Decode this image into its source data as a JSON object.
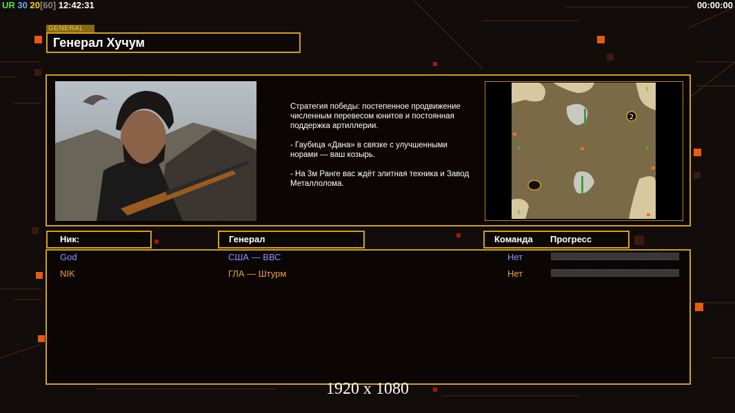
{
  "hud": {
    "fps_label": "UR",
    "fps_value": "30",
    "fps_limit": "20",
    "fps_max": "[60]",
    "clock": "12:42:31",
    "timer": "00:00:00"
  },
  "general": {
    "tag": "GENERAL",
    "name": "Генерал Хучум",
    "strategy": [
      "Стратегия победы: постепенное продвижение численным перевесом юнитов и постоянная поддержка артиллерии.",
      "- Гаубица «Дана» в связке с улучшенными норами — ваш козырь.",
      "- На 3м Ранге вас ждёт элитная техника и Завод Металлолома."
    ],
    "minimap_start_1": "2"
  },
  "table": {
    "headers": {
      "nick": "Ник:",
      "general": "Генерал",
      "team": "Команда",
      "progress": "Прогресс"
    },
    "rows": [
      {
        "nick": "God",
        "general": "США — ВВС",
        "team": "Нет",
        "progress": 0,
        "color": "#8f8fff"
      },
      {
        "nick": "NIK",
        "general": "ГЛА — Штурм",
        "team": "Нет",
        "progress": 0,
        "color": "#f0a040"
      }
    ]
  },
  "footer": {
    "resolution": "1920 x 1080"
  },
  "colors": {
    "accent": "#d4a21a",
    "orange": "#ff6a1a"
  }
}
